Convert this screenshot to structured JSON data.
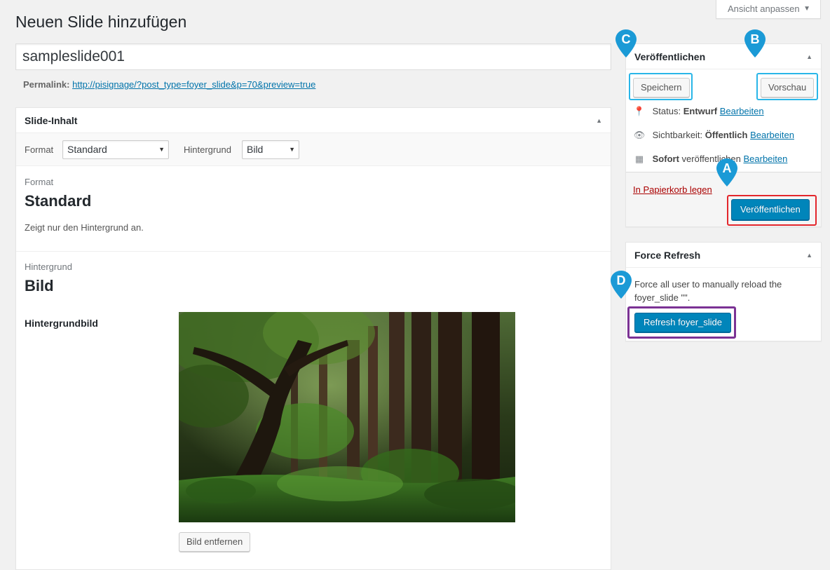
{
  "screen_options": {
    "label": "Ansicht anpassen"
  },
  "page": {
    "title": "Neuen Slide hinzufügen"
  },
  "post_title": {
    "value": "sampleslide001"
  },
  "permalink": {
    "label": "Permalink:",
    "url": "http://pisignage/?post_type=foyer_slide&p=70&preview=true"
  },
  "slide_content": {
    "heading": "Slide-Inhalt",
    "format_label": "Format",
    "format_value": "Standard",
    "background_label": "Hintergrund",
    "background_value": "Bild",
    "format_section": {
      "label": "Format",
      "value": "Standard",
      "description": "Zeigt nur den Hintergrund an."
    },
    "background_section": {
      "label": "Hintergrund",
      "value": "Bild",
      "image_label": "Hintergrundbild",
      "remove_button": "Bild entfernen"
    }
  },
  "publish": {
    "heading": "Veröffentlichen",
    "save_button": "Speichern",
    "preview_button": "Vorschau",
    "status_label": "Status:",
    "status_value": "Entwurf",
    "visibility_label": "Sichtbarkeit:",
    "visibility_value": "Öffentlich",
    "schedule_strong": "Sofort",
    "schedule_text": "veröffentlichen",
    "edit_link": "Bearbeiten",
    "trash_link": "In Papierkorb legen",
    "publish_button": "Veröffentlichen"
  },
  "force_refresh": {
    "heading": "Force Refresh",
    "description": "Force all user to manually reload the foyer_slide \"\".",
    "button": "Refresh foyer_slide"
  },
  "annotations": {
    "a": "A",
    "b": "B",
    "c": "C",
    "d": "D",
    "pin_color": "#1b9ad6"
  },
  "colors": {
    "primary": "#0085ba",
    "link": "#0073aa",
    "trash": "#a00",
    "highlight_cyan": "#29b6e8",
    "highlight_red": "#e3262c",
    "highlight_purple": "#7b3294"
  }
}
